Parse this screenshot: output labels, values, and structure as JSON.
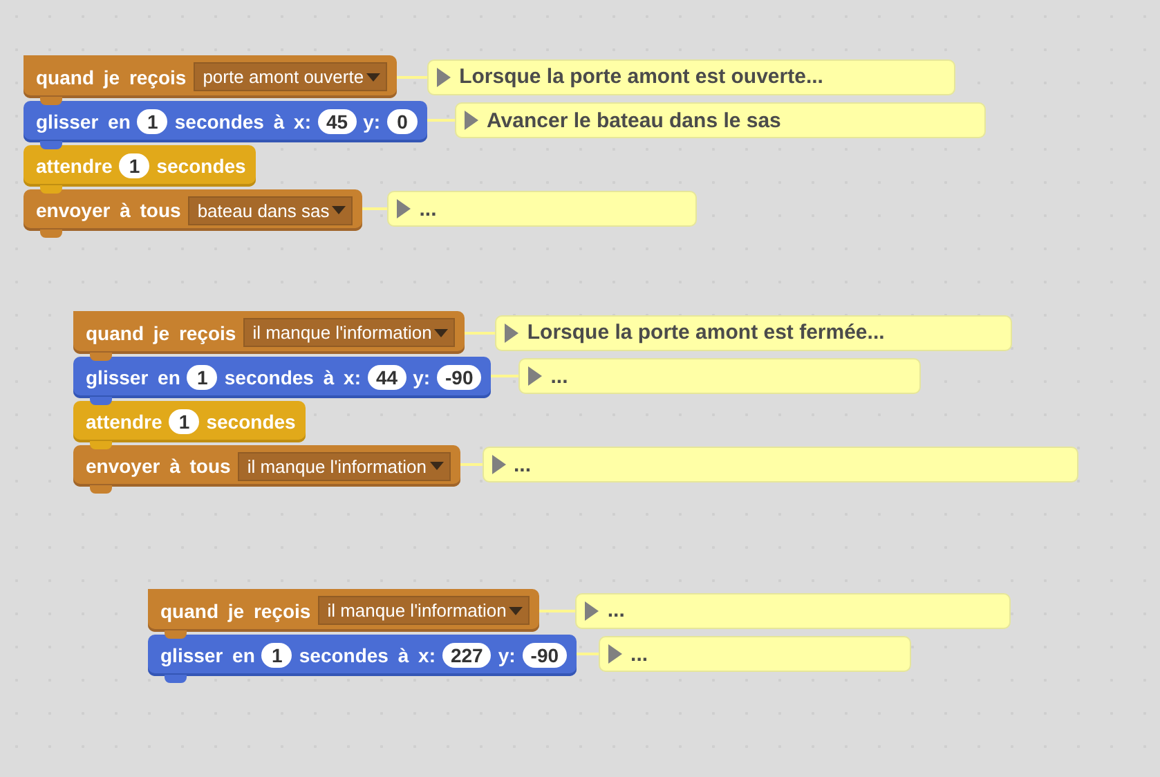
{
  "scripts": [
    {
      "blocks": [
        {
          "kind": "event_hat",
          "parts": [
            {
              "kind": "label",
              "text": "quand je reçois"
            },
            {
              "kind": "dropdown",
              "text": "porte amont ouverte"
            }
          ],
          "comment": "Lorsque la porte amont est ouverte..."
        },
        {
          "kind": "motion",
          "parts": [
            {
              "kind": "label",
              "text": "glisser en"
            },
            {
              "kind": "number",
              "text": "1"
            },
            {
              "kind": "label",
              "text": "secondes à x:"
            },
            {
              "kind": "number",
              "text": "45"
            },
            {
              "kind": "label",
              "text": "y:"
            },
            {
              "kind": "number",
              "text": "0"
            }
          ],
          "comment": "Avancer le bateau dans le sas"
        },
        {
          "kind": "control",
          "parts": [
            {
              "kind": "label",
              "text": "attendre"
            },
            {
              "kind": "number",
              "text": "1"
            },
            {
              "kind": "label",
              "text": "secondes"
            }
          ]
        },
        {
          "kind": "event",
          "parts": [
            {
              "kind": "label",
              "text": "envoyer à tous"
            },
            {
              "kind": "dropdown",
              "text": "bateau dans sas"
            }
          ],
          "comment": "..."
        }
      ]
    },
    {
      "blocks": [
        {
          "kind": "event_hat",
          "parts": [
            {
              "kind": "label",
              "text": "quand je reçois"
            },
            {
              "kind": "dropdown",
              "text": "il manque l'information"
            }
          ],
          "comment": "Lorsque la porte amont est fermée..."
        },
        {
          "kind": "motion",
          "parts": [
            {
              "kind": "label",
              "text": "glisser en"
            },
            {
              "kind": "number",
              "text": "1"
            },
            {
              "kind": "label",
              "text": "secondes à x:"
            },
            {
              "kind": "number",
              "text": "44"
            },
            {
              "kind": "label",
              "text": "y:"
            },
            {
              "kind": "number",
              "text": "-90"
            }
          ],
          "comment": "..."
        },
        {
          "kind": "control",
          "parts": [
            {
              "kind": "label",
              "text": "attendre"
            },
            {
              "kind": "number",
              "text": "1"
            },
            {
              "kind": "label",
              "text": "secondes"
            }
          ]
        },
        {
          "kind": "event",
          "parts": [
            {
              "kind": "label",
              "text": "envoyer à tous"
            },
            {
              "kind": "dropdown",
              "text": "il manque l'information"
            }
          ],
          "comment": "..."
        }
      ]
    },
    {
      "blocks": [
        {
          "kind": "event_hat",
          "parts": [
            {
              "kind": "label",
              "text": "quand je reçois"
            },
            {
              "kind": "dropdown",
              "text": "il manque l'information"
            }
          ],
          "comment": "..."
        },
        {
          "kind": "motion",
          "parts": [
            {
              "kind": "label",
              "text": "glisser en"
            },
            {
              "kind": "number",
              "text": "1"
            },
            {
              "kind": "label",
              "text": "secondes à x:"
            },
            {
              "kind": "number",
              "text": "227"
            },
            {
              "kind": "label",
              "text": "y:"
            },
            {
              "kind": "number",
              "text": "-90"
            }
          ],
          "comment": "..."
        }
      ]
    }
  ]
}
